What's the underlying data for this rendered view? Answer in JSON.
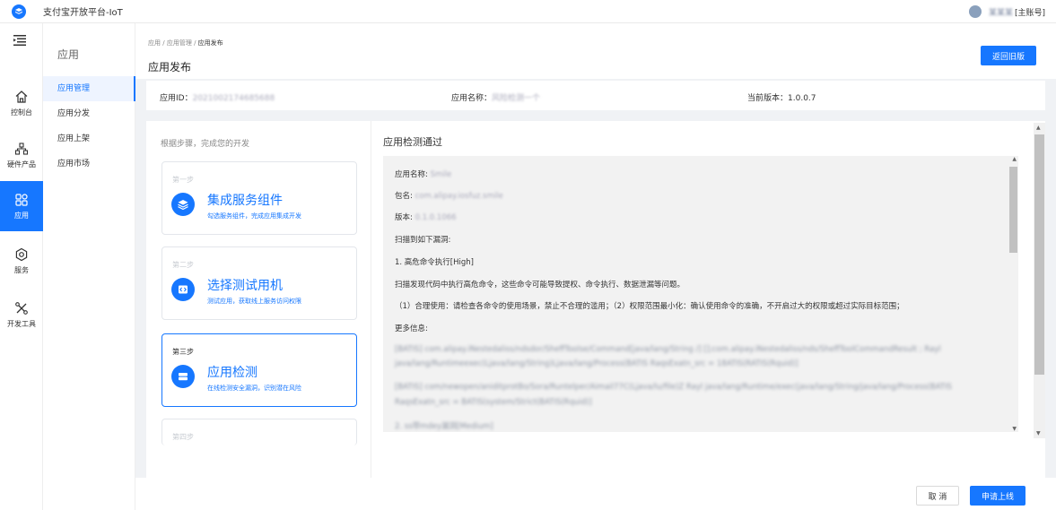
{
  "app": {
    "title": "支付宝开放平台-IoT"
  },
  "user": {
    "name": "某某某",
    "role": "[主账号]"
  },
  "icon_nav": [
    {
      "label": "控制台",
      "icon": "home-icon"
    },
    {
      "label": "硬件产品",
      "icon": "hardware-icon"
    },
    {
      "label": "应用",
      "icon": "apps-icon",
      "active": true
    },
    {
      "label": "服务",
      "icon": "gear-icon"
    },
    {
      "label": "开发工具",
      "icon": "tools-icon"
    }
  ],
  "sub_nav": {
    "title": "应用",
    "items": [
      {
        "label": "应用管理",
        "active": true
      },
      {
        "label": "应用分发"
      },
      {
        "label": "应用上架"
      },
      {
        "label": "应用市场"
      }
    ]
  },
  "header": {
    "breadcrumb": [
      "应用",
      "应用管理",
      "应用发布"
    ],
    "title": "应用发布",
    "return_label": "返回旧版"
  },
  "info": {
    "app_id_label": "应用ID：",
    "app_id_value": "2021002174685688",
    "app_name_label": "应用名称：",
    "app_name_value": "风险检测一个",
    "version_label": "当前版本：",
    "version_value": "1.0.0.7"
  },
  "steps": {
    "hint": "根据步骤，完成您的开发",
    "items": [
      {
        "no": "第一步",
        "title": "集成服务组件",
        "desc": "勾选服务组件，完成应用集成开发",
        "icon": "layers-icon"
      },
      {
        "no": "第二步",
        "title": "选择测试用机",
        "desc": "测试应用，获取线上服务访问权限",
        "icon": "code-icon"
      },
      {
        "no": "第三步",
        "title": "应用检测",
        "desc": "在线检测安全漏洞，识别潜在风险",
        "icon": "device-icon",
        "active": true
      },
      {
        "no": "第四步"
      }
    ]
  },
  "result": {
    "title": "应用检测通过",
    "lines": [
      {
        "text": "应用名称: ",
        "blur": "Smile"
      },
      {
        "text": "包名: ",
        "blur": "com.alipay.iosfuz.smile"
      },
      {
        "text": "版本: ",
        "blur": "0.1.0.1066"
      },
      {
        "text": "扫描到如下漏洞:"
      },
      {
        "text": "1. 高危命令执行[High]"
      },
      {
        "text": "扫描发现代码中执行高危命令，这些命令可能导致提权、命令执行、数据泄漏等问题。"
      },
      {
        "text": "（1）合理使用：请检查各命令的使用场景，禁止不合理的滥用；（2）权限范围最小化：确认使用命令的准确，不开启过大的权限或超过实际目标范围；"
      },
      {
        "text": "更多信息:"
      },
      {
        "blur": "[BATIS] com.alipay.iNestedaliss/ndsdor/SheffToolse/Command[java/lang/String /] [];com.alipay.iNestedaliss/nds/SheffToolCommandResult ; Rayl"
      },
      {
        "blur": "java/lang/Runtimeexec(Ljava/lang/String)Ljava/lang/Process(BATIS RaqsExatn_src = 18ATIS(RATIS(Rquid)]"
      },
      {
        "blur": "[BATIS] com/newopen/aniditprotBo/Sora/Runtelper/Aimail77C(Ljava/lu/file)Z Rayl java/lang/Runtime/exec(java/lang/String/java/lang/Process(BATIS"
      },
      {
        "blur": "RaqsExatn_src = BATIS(system/Strict(BATIS(Rquid)]"
      },
      {
        "blur": "2. ss带mdey漏洞[Medium]"
      }
    ]
  },
  "footer": {
    "cancel_label": "取 消",
    "apply_label": "申请上线"
  },
  "colors": {
    "primary": "#1677ff",
    "background": "#f0f2f5"
  }
}
